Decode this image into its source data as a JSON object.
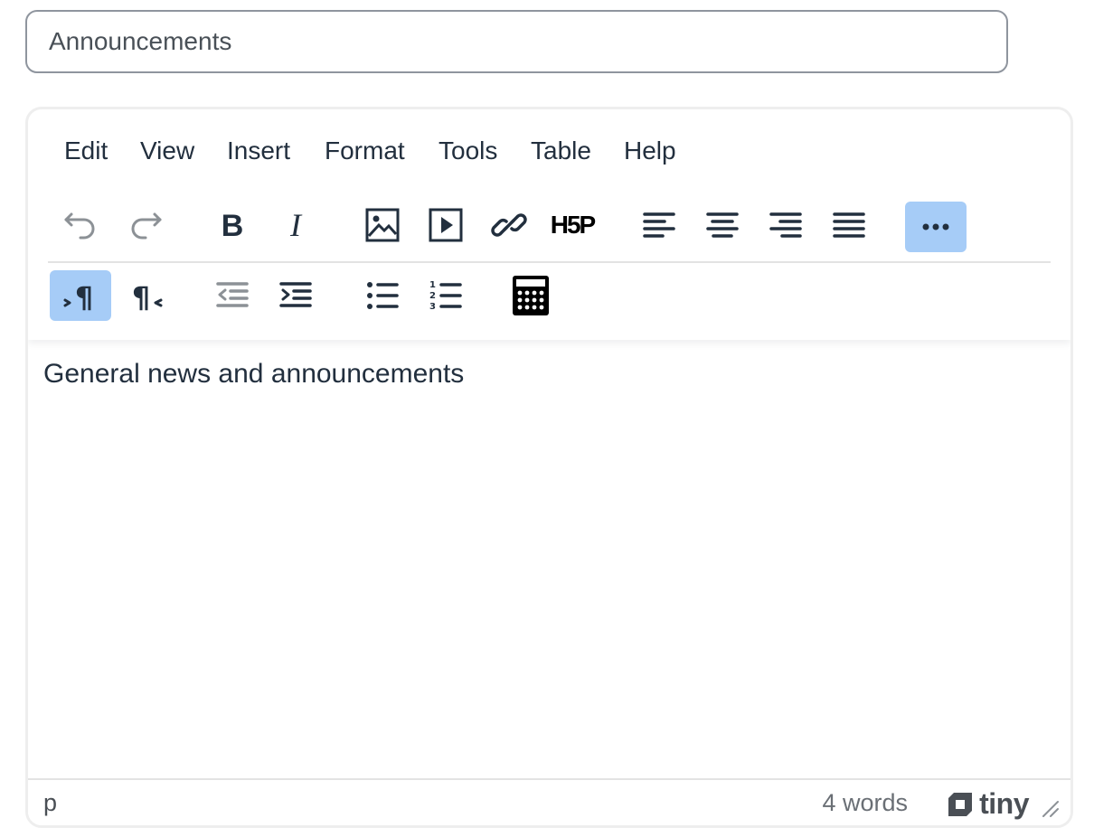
{
  "title_field": {
    "value": "Announcements"
  },
  "menubar": {
    "items": [
      "Edit",
      "View",
      "Insert",
      "Format",
      "Tools",
      "Table",
      "Help"
    ]
  },
  "toolbar": {
    "row1": [
      {
        "icon": "undo-icon",
        "disabled": true
      },
      {
        "icon": "redo-icon",
        "disabled": true
      },
      {
        "icon": "bold-icon"
      },
      {
        "icon": "italic-icon"
      },
      {
        "icon": "image-icon"
      },
      {
        "icon": "media-icon"
      },
      {
        "icon": "link-icon"
      },
      {
        "icon": "h5p-icon",
        "text": "H5P"
      },
      {
        "icon": "align-left-icon"
      },
      {
        "icon": "align-center-icon"
      },
      {
        "icon": "align-right-icon"
      },
      {
        "icon": "align-justify-icon"
      },
      {
        "icon": "more-icon",
        "active": true
      }
    ],
    "row2": [
      {
        "icon": "ltr-icon",
        "active": true
      },
      {
        "icon": "rtl-icon"
      },
      {
        "icon": "outdent-icon",
        "disabled": true
      },
      {
        "icon": "indent-icon"
      },
      {
        "icon": "bullet-list-icon"
      },
      {
        "icon": "numbered-list-icon"
      },
      {
        "icon": "calculator-icon"
      }
    ]
  },
  "content": {
    "text": "General news and announcements"
  },
  "statusbar": {
    "path": "p",
    "word_count": "4 words",
    "brand": "tiny"
  },
  "colors": {
    "active_bg": "#a6ccf7",
    "icon": "#222f3e",
    "disabled_icon": "#8c9196"
  }
}
